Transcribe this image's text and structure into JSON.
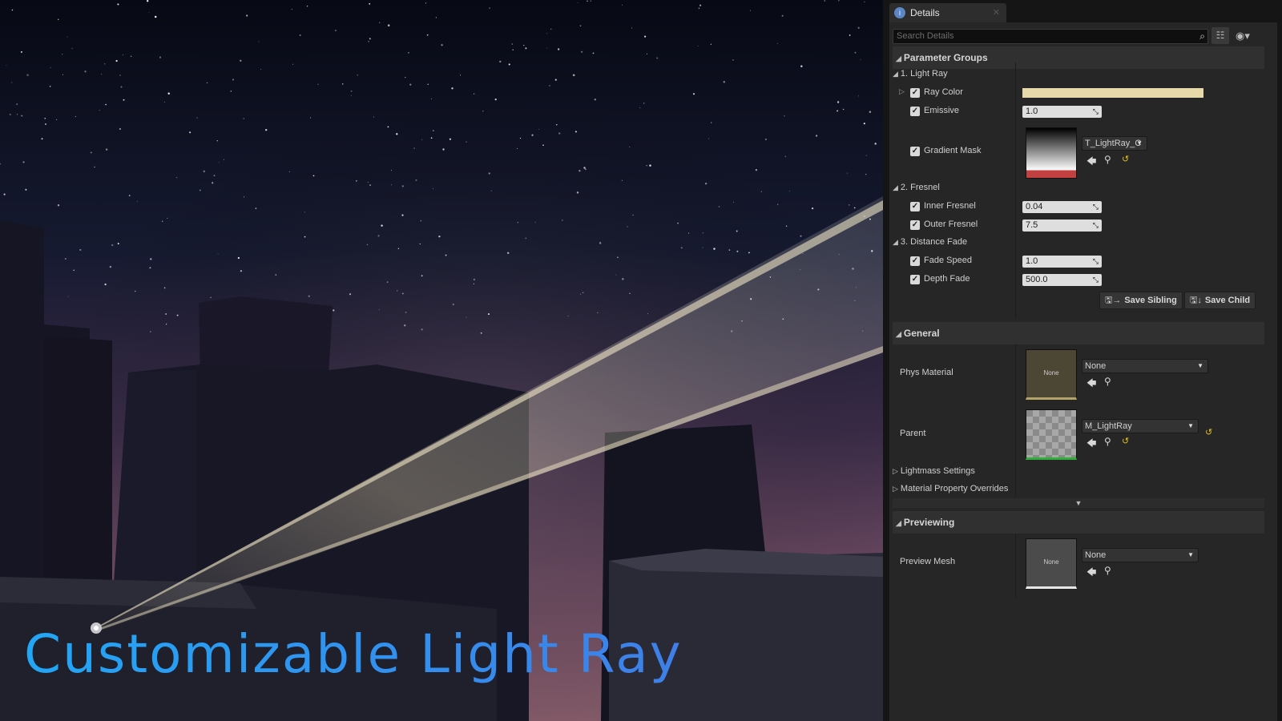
{
  "hero_text": "Customizable Light Ray",
  "panel": {
    "tab_title": "Details",
    "search_placeholder": "Search Details",
    "icons": [
      "details-tab-icon",
      "search-icon",
      "list-view-icon",
      "eye-icon",
      "reset-arrow-icon",
      "browse-arrow-icon",
      "magnifier-icon",
      "save-icon"
    ],
    "parameter_groups": {
      "title": "Parameter Groups",
      "groups": [
        {
          "name": "1. Light Ray",
          "params": [
            {
              "label": "Ray Color",
              "type": "color",
              "value_hex": "#e8d9ab"
            },
            {
              "label": "Emissive",
              "type": "number",
              "value": "1.0"
            },
            {
              "label": "Gradient Mask",
              "type": "texture",
              "value": "T_LightRay_C"
            }
          ]
        },
        {
          "name": "2. Fresnel",
          "params": [
            {
              "label": "Inner Fresnel",
              "type": "number",
              "value": "0.04"
            },
            {
              "label": "Outer Fresnel",
              "type": "number",
              "value": "7.5"
            }
          ]
        },
        {
          "name": "3. Distance Fade",
          "params": [
            {
              "label": "Fade Speed",
              "type": "number",
              "value": "1.0"
            },
            {
              "label": "Depth Fade",
              "type": "number",
              "value": "500.0"
            }
          ]
        }
      ],
      "save_sibling": "Save Sibling",
      "save_child": "Save Child"
    },
    "general": {
      "title": "General",
      "phys_material": {
        "label": "Phys Material",
        "thumb_text": "None",
        "value": "None"
      },
      "parent": {
        "label": "Parent",
        "value": "M_LightRay"
      },
      "lightmass": "Lightmass Settings",
      "overrides": "Material Property Overrides"
    },
    "previewing": {
      "title": "Previewing",
      "preview_mesh": {
        "label": "Preview Mesh",
        "thumb_text": "None",
        "value": "None"
      }
    }
  },
  "colors": {
    "hero_text": "#2b9cf0",
    "panel_bg": "#262626",
    "section_bg": "#303030",
    "ray_color": "#e8d9ab",
    "reset_yellow": "#e0c020"
  }
}
